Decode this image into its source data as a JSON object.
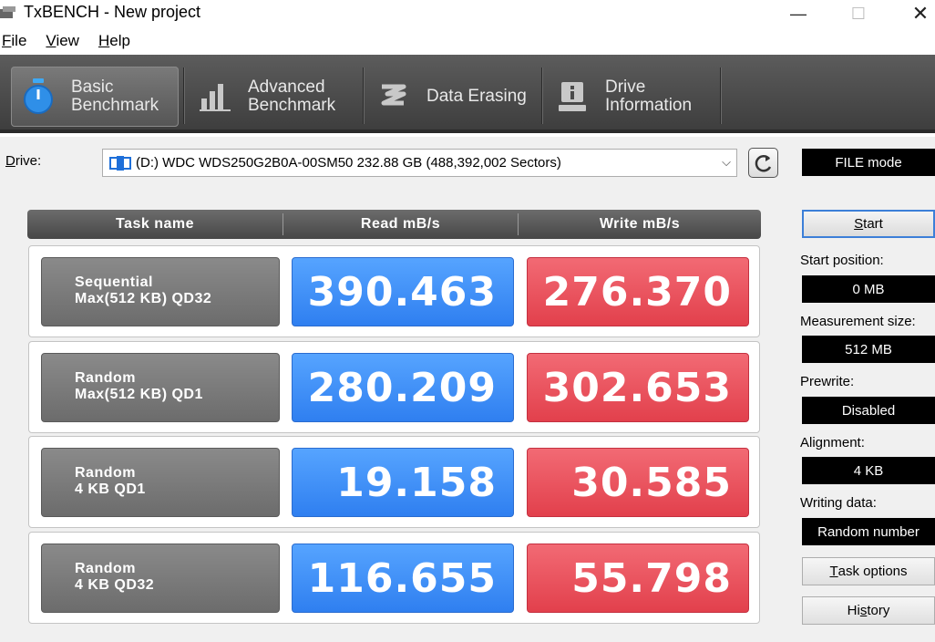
{
  "window": {
    "title": "TxBENCH - New project",
    "minimize": "—",
    "maximize": "☐",
    "close": "✕"
  },
  "menu": [
    {
      "label": "File",
      "accel": "F",
      "rest": "ile"
    },
    {
      "label": "View",
      "accel": "V",
      "rest": "iew"
    },
    {
      "label": "Help",
      "accel": "H",
      "rest": "elp"
    }
  ],
  "toolbar": {
    "tabs": [
      {
        "line1": "Basic",
        "line2": "Benchmark",
        "icon": "stopwatch-icon",
        "active": true
      },
      {
        "line1": "Advanced",
        "line2": "Benchmark",
        "icon": "bar-chart-icon",
        "active": false
      },
      {
        "line1": "Data Erasing",
        "line2": "",
        "icon": "eraser-icon",
        "active": false
      },
      {
        "line1": "Drive",
        "line2": "Information",
        "icon": "drive-info-icon",
        "active": false
      }
    ]
  },
  "drive": {
    "label_accel": "D",
    "label_rest": "rive:",
    "selected": "(D:) WDC WDS250G2B0A-00SM50  232.88 GB (488,392,002 Sectors)"
  },
  "table": {
    "headers": [
      "Task name",
      "Read mB/s",
      "Write mB/s"
    ],
    "rows": [
      {
        "line1": "Sequential",
        "line2": "Max(512 KB) QD32",
        "read": "390.463",
        "write": "276.370"
      },
      {
        "line1": "Random",
        "line2": "Max(512 KB) QD1",
        "read": "280.209",
        "write": "302.653"
      },
      {
        "line1": "Random",
        "line2": "4 KB QD1",
        "read": "19.158",
        "write": "30.585"
      },
      {
        "line1": "Random",
        "line2": "4 KB QD32",
        "read": "116.655",
        "write": "55.798"
      }
    ]
  },
  "side": {
    "mode": "FILE mode",
    "start_accel": "S",
    "start_rest": "tart",
    "start_position_label": "Start position:",
    "start_position": "0 MB",
    "measurement_size_label": "Measurement size:",
    "measurement_size": "512 MB",
    "prewrite_label": "Prewrite:",
    "prewrite": "Disabled",
    "alignment_label": "Alignment:",
    "alignment": "4 KB",
    "writing_data_label": "Writing data:",
    "writing_data": "Random number",
    "task_options_accel": "T",
    "task_options_rest": "ask options",
    "history_pre": "Hi",
    "history_accel": "s",
    "history_rest": "tory"
  },
  "colors": {
    "read": "#3b8cf6",
    "write": "#e84f5a",
    "toolbar": "#4a4a4a"
  }
}
